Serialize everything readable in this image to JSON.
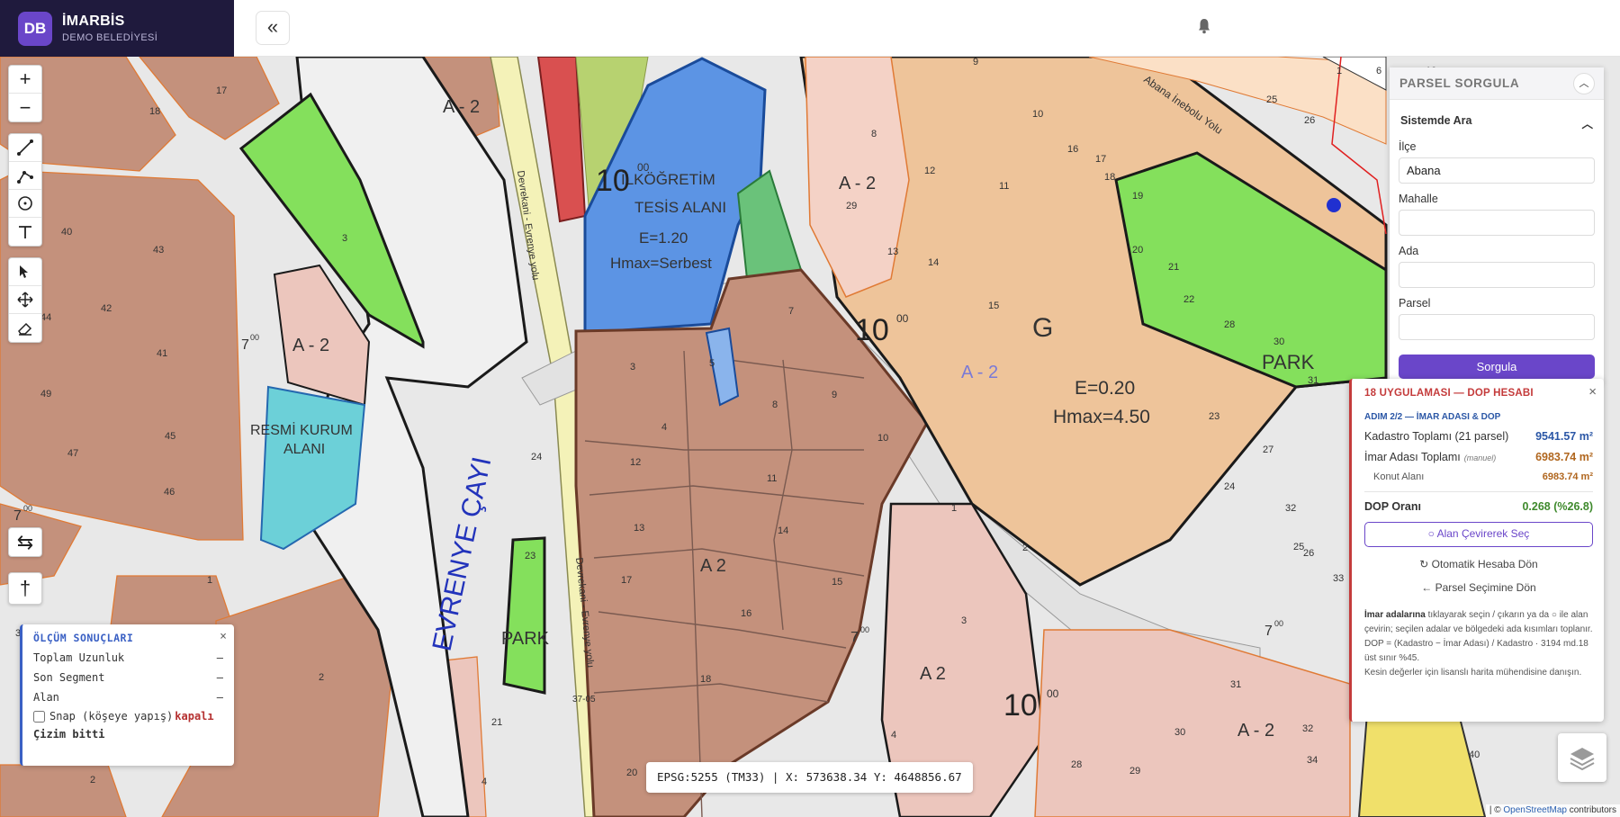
{
  "brand": {
    "logo_text": "DB",
    "title": "İMARBİS",
    "subtitle": "DEMO BELEDİYESİ"
  },
  "header": {
    "collapse_glyph": "«",
    "bell_icon": "bell-icon"
  },
  "toolbar": {
    "zoom_in": "+",
    "zoom_out": "−",
    "swap_glyph": "⇆",
    "north_glyph": "†"
  },
  "map_labels": {
    "street_top": "Abana İnebolu Yolu",
    "road_left": "Devrekani - Evrenye yolu",
    "road_lower": "Devrekani - Evrenye yolu",
    "river": "EVRENYE ÇAYI",
    "school_1": "İLKÖĞRETİM",
    "school_2": "TESİS ALANI",
    "school_e": "E=1.20",
    "school_h": "Hmax=Serbest",
    "resmi_1": "RESMİ KURUM",
    "resmi_2": "ALANI",
    "park_right": "PARK",
    "park_lower": "PARK",
    "zone_g": "G",
    "g_e": "E=0.20",
    "g_h": "Hmax=4.50",
    "a2_1": "A - 2",
    "a2_2": "A - 2",
    "a2_3": "A - 2",
    "a2_4": "A  2",
    "a2_5": "A  2",
    "a2_6": "A - 2",
    "a2_7": "A - 2",
    "road_width_1": "10",
    "road_width_2": "10",
    "road_width_3": "10",
    "road_width_4": "7",
    "road_width_5": "7",
    "road_width_6": "7",
    "road_width_7": "7",
    "sup_00": "00",
    "road_code": "37-05",
    "parcels_center": [
      "3",
      "4",
      "5",
      "7",
      "8",
      "9",
      "10",
      "11",
      "12",
      "13",
      "14",
      "15",
      "16",
      "17",
      "18",
      "20"
    ],
    "parcels_left": [
      "17",
      "18",
      "40",
      "43",
      "42",
      "44",
      "41",
      "49",
      "45",
      "47",
      "46",
      "3",
      "1",
      "3",
      "2",
      "2",
      "21",
      "4",
      "24",
      "23"
    ],
    "parcels_right": [
      "9",
      "10",
      "12",
      "11",
      "16",
      "17",
      "18",
      "8",
      "13",
      "14",
      "15",
      "29",
      "19",
      "20",
      "21",
      "22",
      "28",
      "30",
      "31",
      "27",
      "24",
      "23",
      "25",
      "26",
      "32",
      "33",
      "1",
      "2",
      "3",
      "28",
      "29",
      "30",
      "31",
      "32",
      "34",
      "40",
      "25",
      "26",
      "1",
      "10",
      "6",
      "4"
    ]
  },
  "measure": {
    "title": "ÖLÇÜM SONUÇLARI",
    "close": "×",
    "rows": [
      {
        "label": "Toplam Uzunluk",
        "value": "–"
      },
      {
        "label": "Son Segment",
        "value": "–"
      },
      {
        "label": "Alan",
        "value": "–"
      }
    ],
    "snap_label": "Snap (köşeye yapış)",
    "snap_state": "kapalı",
    "done": "Çizim bitti"
  },
  "coords": {
    "text": "EPSG:5255 (TM33) | X: 573638.34  Y: 4648856.67"
  },
  "parsel": {
    "title": "PARSEL SORGULA",
    "section": "Sistemde Ara",
    "fields": [
      {
        "label": "İlçe",
        "value": "Abana"
      },
      {
        "label": "Mahalle",
        "value": ""
      },
      {
        "label": "Ada",
        "value": ""
      },
      {
        "label": "Parsel",
        "value": ""
      }
    ],
    "button": "Sorgula"
  },
  "dop": {
    "title": "18 UYGULAMASI — DOP HESABI",
    "close": "×",
    "step": "ADIM 2/2 — İMAR ADASI & DOP",
    "kadastro_label": "Kadastro Toplamı (21 parsel)",
    "kadastro_value": "9541.57 m²",
    "imar_label": "İmar Adası Toplamı",
    "imar_tag": "(manuel)",
    "imar_value": "6983.74 m²",
    "konut_label": "Konut Alanı",
    "konut_value": "6983.74 m²",
    "dop_label": "DOP Oranı",
    "dop_value": "0.268 (%26.8)",
    "select_btn": "○ Alan Çevirerek Seç",
    "auto_btn": "↻ Otomatik Hesaba Dön",
    "back_btn": "← Parsel Seçimine Dön",
    "note_bold": "İmar adalarına",
    "note_1": " tıklayarak seçin / çıkarın ya da ○ ile alan çevirin; seçilen adalar ve bölgedeki ada kısımları toplanır.",
    "note_2": "DOP = (Kadastro − İmar Adası) / Kadastro · 3194 md.18 üst sınır %45.",
    "note_3": "Kesin değerler için lisanslı harita mühendisine danışın."
  },
  "attribution": {
    "prefix": "| © ",
    "link": "OpenStreetMap",
    "suffix": " contributors"
  },
  "colors": {
    "brand_bg": "#1f1a3d",
    "accent": "#6a46c9",
    "residential_brown": "#c4917c",
    "residential_pink": "#ecc6bd",
    "residential_orange": "#eec49a",
    "park_green": "#84e05c",
    "school_blue": "#5c94e4",
    "official_cyan": "#6cd0d8",
    "road_yellow": "#f4f2b8",
    "road_gray": "#e7e7e7"
  }
}
